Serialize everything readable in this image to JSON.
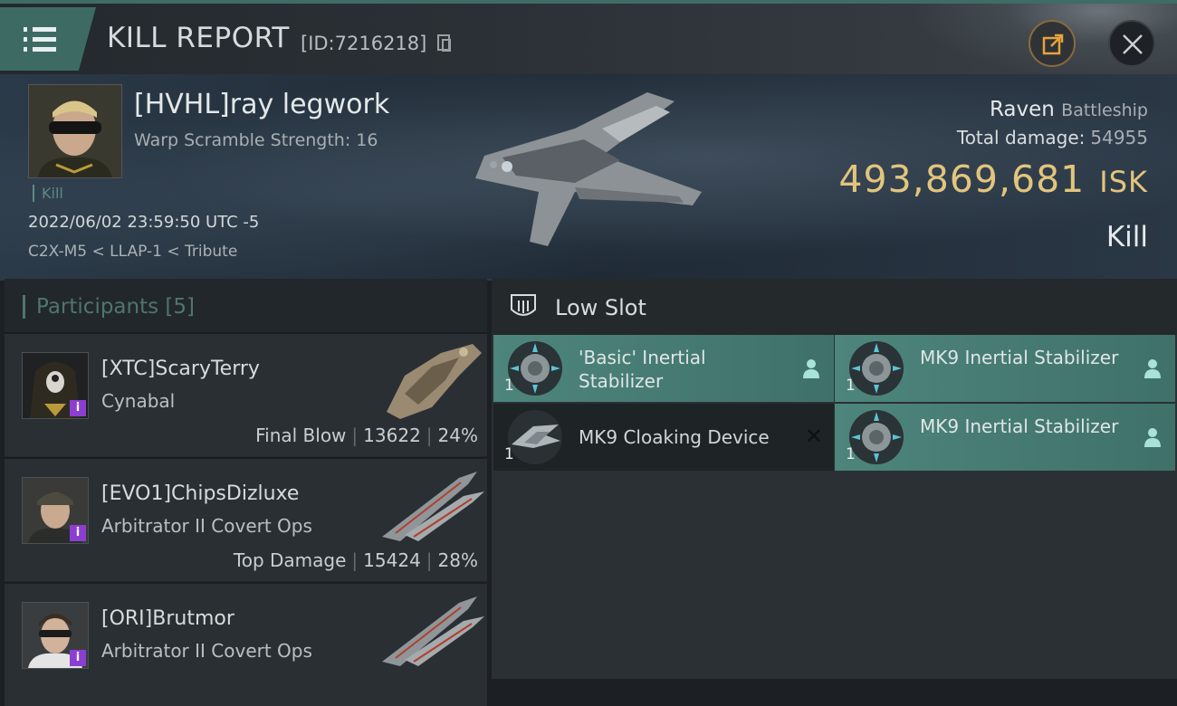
{
  "window": {
    "title": "KILL REPORT",
    "kill_id": "[ID:7216218]"
  },
  "victim": {
    "name": "[HVHL]ray legwork",
    "subtitle": "Warp Scramble Strength: 16",
    "tag": "Kill",
    "time": "2022/06/02 23:59:50 UTC -5",
    "location": "C2X-M5 < LLAP-1 < Tribute",
    "ship": "Raven",
    "ship_class": "Battleship",
    "total_damage_label": "Total damage:",
    "total_damage": "54955",
    "isk_value": "493,869,681",
    "isk_currency": "ISK",
    "result": "Kill"
  },
  "participants": {
    "header": "Participants",
    "count": "[5]",
    "items": [
      {
        "name": "[XTC]ScaryTerry",
        "ship": "Cynabal",
        "label": "Final Blow",
        "damage": "13622",
        "percent": "24%"
      },
      {
        "name": "[EVO1]ChipsDizluxe",
        "ship": "Arbitrator II Covert Ops",
        "label": "Top Damage",
        "damage": "15424",
        "percent": "28%"
      },
      {
        "name": "[ORI]Brutmor",
        "ship": "Arbitrator II Covert Ops",
        "label": "",
        "damage": "",
        "percent": ""
      }
    ]
  },
  "low_slot": {
    "title": "Low Slot",
    "items": [
      {
        "name": "'Basic' Inertial Stabilizer",
        "qty": "1",
        "state": "dropped"
      },
      {
        "name": "MK9 Inertial Stabilizer",
        "qty": "1",
        "state": "dropped"
      },
      {
        "name": "MK9 Cloaking Device",
        "qty": "1",
        "state": "destroyed"
      },
      {
        "name": "MK9 Inertial Stabilizer",
        "qty": "1",
        "state": "dropped"
      }
    ]
  },
  "colors": {
    "accent_teal": "#4d857c",
    "isk_gold": "#e2c57c",
    "info_purple": "#8a3fd1"
  },
  "icons": [
    "menu-icon",
    "copy-icon",
    "share-icon",
    "close-icon",
    "low-slot-icon",
    "person-icon",
    "info-icon",
    "destroyed-x-icon"
  ]
}
